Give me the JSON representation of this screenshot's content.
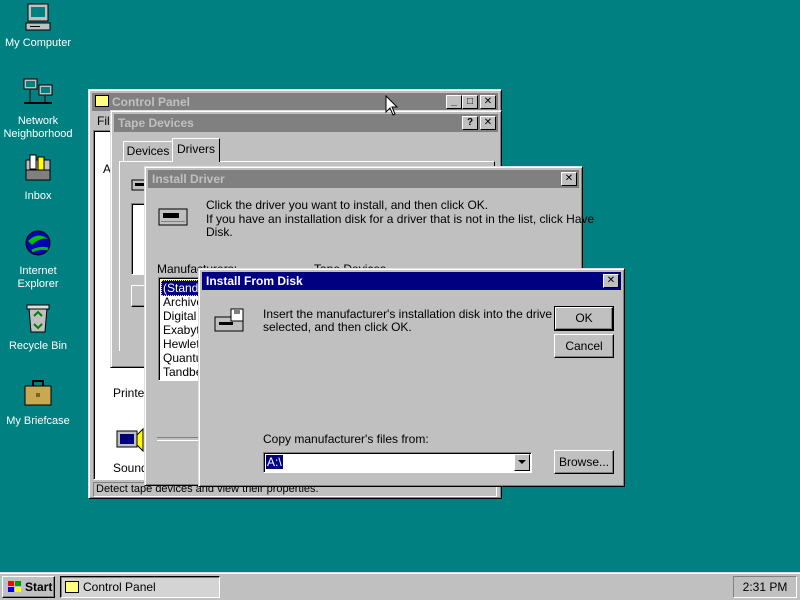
{
  "desktop": {
    "icons": [
      {
        "label": "My Computer"
      },
      {
        "label": "Network Neighborhood"
      },
      {
        "label": "Inbox"
      },
      {
        "label": "Internet Explorer"
      },
      {
        "label": "Recycle Bin"
      },
      {
        "label": "My Briefcase"
      }
    ]
  },
  "control_panel": {
    "title": "Control Panel",
    "menu_first": "File",
    "partial_item_a": "A",
    "item_printers": "Printers",
    "item_sounds": "Sounds",
    "status": "Detect tape devices and view their properties."
  },
  "tape_devices": {
    "title": "Tape Devices",
    "tabs": [
      "Devices",
      "Drivers"
    ],
    "active_tab": "Drivers"
  },
  "install_driver": {
    "title": "Install Driver",
    "instruction1": "Click the driver you want to install, and then click OK.",
    "instruction2": "If you have an installation disk for a driver that is not in the list, click Have",
    "instruction3": "Disk.",
    "manufacturers_label": "Manufacturers:",
    "tape_devices_label": "Tape Devices",
    "manufacturers": [
      "(Standa",
      "Archive",
      "Digital",
      "Exabyte",
      "Hewlet",
      "Quantu",
      "Tandbe"
    ]
  },
  "install_from_disk": {
    "title": "Install From Disk",
    "message1": "Insert the manufacturer's installation disk into the drive",
    "message2": "selected, and then click OK.",
    "ok_label": "OK",
    "cancel_label": "Cancel",
    "copy_label": "Copy manufacturer's files from:",
    "copy_value": "A:\\",
    "browse_label": "Browse..."
  },
  "taskbar": {
    "start_label": "Start",
    "task_label": "Control Panel",
    "clock": "2:31 PM"
  },
  "colors": {
    "desktop": "#008080",
    "active_title": "#000080",
    "inactive_title": "#808080",
    "face": "#c0c0c0"
  }
}
